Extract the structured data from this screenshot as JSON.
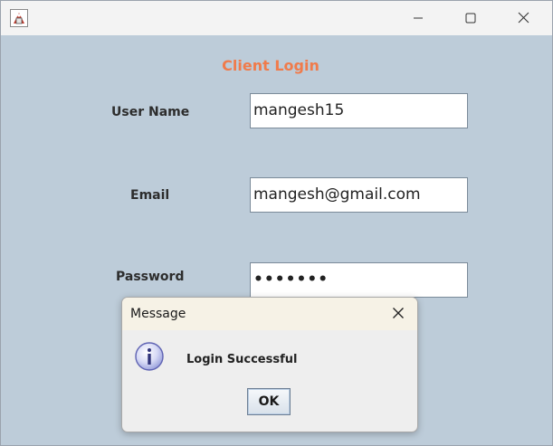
{
  "window": {
    "form_heading": "Client Login",
    "app_icon": "java-app-icon",
    "controls": {
      "minimize_icon": "minimize-icon",
      "maximize_icon": "maximize-icon",
      "close_icon": "close-icon"
    }
  },
  "form": {
    "username_label": "User Name",
    "username_value": "mangesh15",
    "email_label": "Email",
    "email_value": "mangesh@gmail.com",
    "password_label": "Password",
    "password_masked": "•••••••"
  },
  "dialog": {
    "title": "Message",
    "icon": "info-icon",
    "message": "Login Successful",
    "ok_label": "OK"
  },
  "colors": {
    "panel_background": "#bdccd9",
    "heading_color": "#f07b4b",
    "dialog_titlebar": "#f6f2e6"
  }
}
